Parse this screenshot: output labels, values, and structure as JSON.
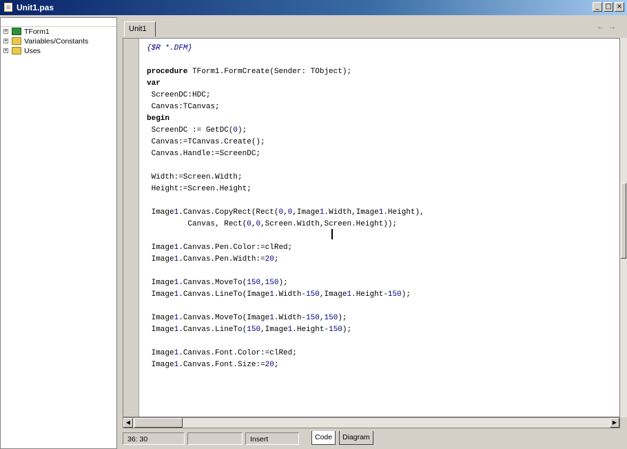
{
  "window": {
    "title": "Unit1.pas",
    "controls": [
      "_",
      "□",
      "×"
    ]
  },
  "explorer": {
    "items": [
      {
        "label": "TForm1",
        "icon": "form-icon",
        "expander": "+"
      },
      {
        "label": "Variables/Constants",
        "icon": "folder-icon",
        "expander": "+"
      },
      {
        "label": "Uses",
        "icon": "folder-icon",
        "expander": "+"
      }
    ]
  },
  "editor": {
    "tab_label": "Unit1",
    "nav": {
      "back": "←",
      "forward": "→"
    },
    "code_lines": [
      {
        "type": "cm",
        "text": "{$R *.DFM}"
      },
      {
        "type": "blank",
        "text": ""
      },
      {
        "type": "proc",
        "kw": "procedure",
        "text": " TForm1.FormCreate(Sender: TObject);"
      },
      {
        "type": "kwline",
        "kw": "var",
        "text": ""
      },
      {
        "type": "plain",
        "text": " ScreenDC:HDC;"
      },
      {
        "type": "plain",
        "text": " Canvas:TCanvas;"
      },
      {
        "type": "kwline",
        "kw": "begin",
        "text": ""
      },
      {
        "type": "plain",
        "text": " ScreenDC := GetDC(0);"
      },
      {
        "type": "plain",
        "text": " Canvas:=TCanvas.Create();"
      },
      {
        "type": "plain",
        "text": " Canvas.Handle:=ScreenDC;"
      },
      {
        "type": "blank",
        "text": ""
      },
      {
        "type": "plain",
        "text": " Width:=Screen.Width;"
      },
      {
        "type": "plain",
        "text": " Height:=Screen.Height;"
      },
      {
        "type": "blank",
        "text": ""
      },
      {
        "type": "plain",
        "text": " Image1.Canvas.CopyRect(Rect(0,0,Image1.Width,Image1.Height),"
      },
      {
        "type": "plain",
        "text": "         Canvas, Rect(0,0,Screen.Width,Screen.Height));"
      },
      {
        "type": "blank",
        "text": ""
      },
      {
        "type": "plain",
        "text": " Image1.Canvas.Pen.Color:=clRed;"
      },
      {
        "type": "plain",
        "text": " Image1.Canvas.Pen.Width:=20;"
      },
      {
        "type": "blank",
        "text": ""
      },
      {
        "type": "plain",
        "text": " Image1.Canvas.MoveTo(150,150);"
      },
      {
        "type": "plain",
        "text": " Image1.Canvas.LineTo(Image1.Width-150,Image1.Height-150);"
      },
      {
        "type": "blank",
        "text": ""
      },
      {
        "type": "plain",
        "text": " Image1.Canvas.MoveTo(Image1.Width-150,150);"
      },
      {
        "type": "plain",
        "text": " Image1.Canvas.LineTo(150,Image1.Height-150);"
      },
      {
        "type": "blank",
        "text": ""
      },
      {
        "type": "plain",
        "text": " Image1.Canvas.Font.Color:=clRed;"
      },
      {
        "type": "plain",
        "text": " Image1.Canvas.Font.Size:=20;"
      }
    ]
  },
  "status": {
    "position": "36: 30",
    "mode": "Insert",
    "tabs": [
      "Code",
      "Diagram"
    ]
  }
}
